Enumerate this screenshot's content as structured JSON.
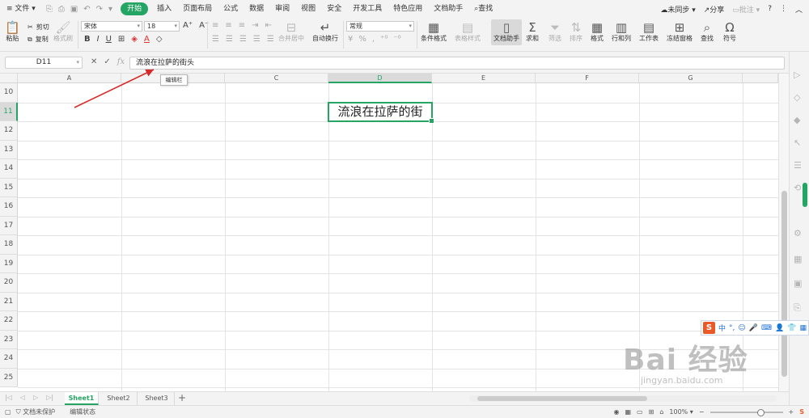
{
  "menubar": {
    "file": "文件",
    "tabs": [
      "开始",
      "插入",
      "页面布局",
      "公式",
      "数据",
      "审阅",
      "视图",
      "安全",
      "开发工具",
      "特色应用",
      "文档助手"
    ],
    "active_tab": "开始",
    "search": "查找",
    "sync": "未同步",
    "share": "分享",
    "comment": "批注"
  },
  "ribbon": {
    "paste": "粘贴",
    "cut": "剪切",
    "copy": "复制",
    "format_painter": "格式刷",
    "font_name": "宋体",
    "font_size": "18",
    "merge_center": "合并居中",
    "wrap": "自动换行",
    "number_format": "常规",
    "cond_format": "条件格式",
    "table_style": "表格样式",
    "doc_helper": "文档助手",
    "sum": "求和",
    "filter": "筛选",
    "sort": "排序",
    "format": "格式",
    "row_col": "行和列",
    "worksheet": "工作表",
    "freeze": "冻结窗格",
    "find": "查找",
    "symbol": "符号"
  },
  "formula_bar": {
    "cell_ref": "D11",
    "content": "流浪在拉萨的街头",
    "fx": "fx"
  },
  "tooltip": "编辑栏",
  "columns": [
    "A",
    "B",
    "C",
    "D",
    "E",
    "F",
    "G"
  ],
  "selected_column": "D",
  "rows": [
    "10",
    "11",
    "12",
    "13",
    "14",
    "15",
    "16",
    "17",
    "18",
    "19",
    "20",
    "21",
    "22",
    "23",
    "24",
    "25"
  ],
  "selected_row": "11",
  "cell_value": "流浪在拉萨的街",
  "sheets": [
    "Sheet1",
    "Sheet2",
    "Sheet3"
  ],
  "active_sheet": "Sheet1",
  "status": {
    "protect": "文档未保护",
    "mode": "编辑状态",
    "zoom": "100%"
  },
  "ime": {
    "logo": "S",
    "lang": "中"
  },
  "watermark": {
    "brand": "Bai 经验",
    "url": "jingyan.baidu.com"
  },
  "colors": {
    "accent": "#25a563",
    "arrow": "#d62a2a"
  }
}
